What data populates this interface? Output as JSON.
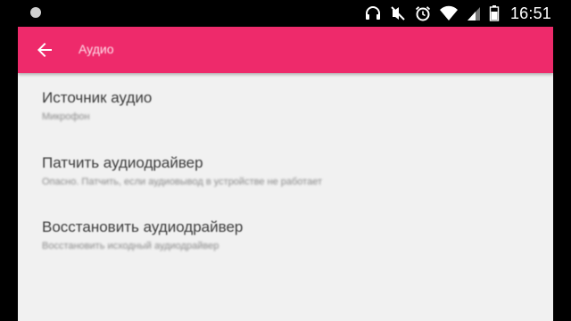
{
  "status_bar": {
    "time": "16:51",
    "icons": [
      "headphones-icon",
      "mute-icon",
      "alarm-icon",
      "wifi-icon",
      "signal-icon",
      "battery-icon"
    ]
  },
  "app_bar": {
    "title": "Аудио",
    "background_color": "#ee2a6b",
    "back_icon": "arrow-left-icon"
  },
  "settings": [
    {
      "title": "Источник аудио",
      "summary": "Микрофон"
    },
    {
      "title": "Патчить аудиодрайвер",
      "summary": "Опасно. Патчить, если аудиовывод в устройстве не работает"
    },
    {
      "title": "Восстановить аудиодрайвер",
      "summary": "Восстановить исходный аудиодрайвер"
    }
  ]
}
